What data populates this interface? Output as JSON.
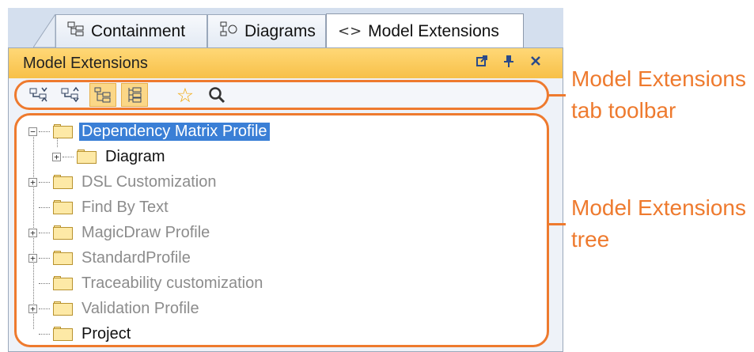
{
  "tabs": [
    {
      "label": "Containment",
      "icon": "containment-icon",
      "active": false
    },
    {
      "label": "Diagrams",
      "icon": "diagrams-icon",
      "active": false
    },
    {
      "label": "Model Extensions",
      "icon": "code-brackets-icon",
      "active": true
    }
  ],
  "panel": {
    "title": "Model Extensions",
    "header_icons": [
      "float-icon",
      "pin-icon",
      "close-icon"
    ]
  },
  "toolbar": {
    "buttons": [
      {
        "icon": "expand-all-icon",
        "toggled": false
      },
      {
        "icon": "collapse-all-icon",
        "toggled": false
      },
      {
        "icon": "show-tree-icon",
        "toggled": true
      },
      {
        "icon": "show-list-icon",
        "toggled": true
      },
      {
        "icon": "favorites-star-icon",
        "toggled": false
      },
      {
        "icon": "search-icon",
        "toggled": false
      }
    ],
    "tab_glyph": "<>"
  },
  "tree": {
    "items": [
      {
        "label": "Dependency Matrix Profile",
        "expander": "−",
        "selected": true,
        "style": "selected",
        "depth": 0
      },
      {
        "label": "Diagram",
        "expander": "+",
        "selected": false,
        "style": "normal",
        "depth": 1
      },
      {
        "label": "DSL Customization",
        "expander": "+",
        "selected": false,
        "style": "dim",
        "depth": 0
      },
      {
        "label": "Find By Text",
        "expander": "",
        "selected": false,
        "style": "dim",
        "depth": 0
      },
      {
        "label": "MagicDraw Profile",
        "expander": "+",
        "selected": false,
        "style": "dim",
        "depth": 0
      },
      {
        "label": "StandardProfile",
        "expander": "+",
        "selected": false,
        "style": "dim",
        "depth": 0
      },
      {
        "label": "Traceability customization",
        "expander": "",
        "selected": false,
        "style": "dim",
        "depth": 0
      },
      {
        "label": "Validation Profile",
        "expander": "+",
        "selected": false,
        "style": "dim",
        "depth": 0
      },
      {
        "label": "Project",
        "expander": "",
        "selected": false,
        "style": "normal",
        "depth": 0
      }
    ]
  },
  "callouts": {
    "toolbar_line1": "Model Extensions",
    "toolbar_line2": "tab toolbar",
    "tree_line1": "Model Extensions",
    "tree_line2": "tree"
  },
  "colors": {
    "accent": "#ee7a2e",
    "header": "#f7c048",
    "selection": "#3a7fd6"
  }
}
